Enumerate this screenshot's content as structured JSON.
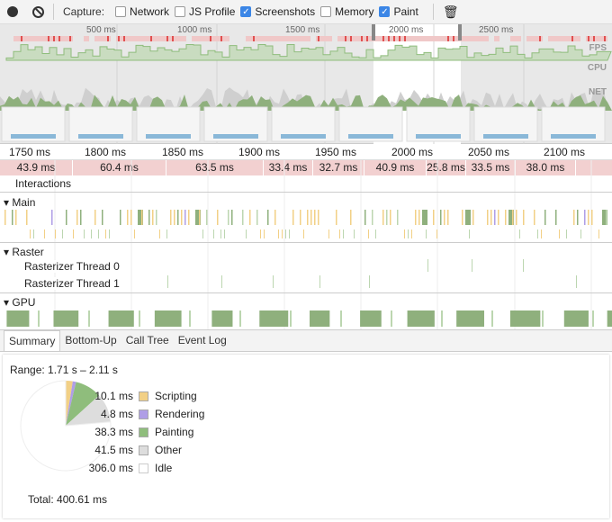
{
  "toolbar": {
    "capture_label": "Capture:",
    "record_icon": "record-icon",
    "clear_icon": "clear-icon",
    "trash_icon": "trash-icon",
    "options": [
      {
        "label": "Network",
        "checked": false
      },
      {
        "label": "JS Profile",
        "checked": false
      },
      {
        "label": "Screenshots",
        "checked": true
      },
      {
        "label": "Memory",
        "checked": false
      },
      {
        "label": "Paint",
        "checked": true
      }
    ]
  },
  "overview": {
    "ticks": [
      "500 ms",
      "1000 ms",
      "1500 ms",
      "2000 ms",
      "2500 ms"
    ],
    "tracks": [
      "FPS",
      "CPU",
      "NET"
    ]
  },
  "ruler": {
    "ticks": [
      "1750 ms",
      "1800 ms",
      "1850 ms",
      "1900 ms",
      "1950 ms",
      "2000 ms",
      "2050 ms",
      "2100 ms"
    ]
  },
  "frames": [
    "43.9 ms",
    "60.4 ms",
    "63.5 ms",
    "33.4 ms",
    "32.7 ms",
    "40.9 ms",
    "25.8 ms",
    "33.5 ms",
    "38.0 ms"
  ],
  "sections": {
    "interactions": "Interactions",
    "main": "Main",
    "raster": "Raster",
    "raster_threads": [
      "Rasterizer Thread 0",
      "Rasterizer Thread 1"
    ],
    "gpu": "GPU"
  },
  "tabs": [
    "Summary",
    "Bottom-Up",
    "Call Tree",
    "Event Log"
  ],
  "summary": {
    "range": "Range: 1.71 s – 2.11 s",
    "total": "Total: 400.61 ms",
    "items": [
      {
        "value": "10.1 ms",
        "label": "Scripting",
        "color": "#f2d086",
        "ms": 10.1
      },
      {
        "value": "4.8 ms",
        "label": "Rendering",
        "color": "#af9ee6",
        "ms": 4.8
      },
      {
        "value": "38.3 ms",
        "label": "Painting",
        "color": "#8fbd7c",
        "ms": 38.3
      },
      {
        "value": "41.5 ms",
        "label": "Other",
        "color": "#dddddd",
        "ms": 41.5
      },
      {
        "value": "306.0 ms",
        "label": "Idle",
        "color": "#ffffff",
        "ms": 306.0
      }
    ]
  }
}
